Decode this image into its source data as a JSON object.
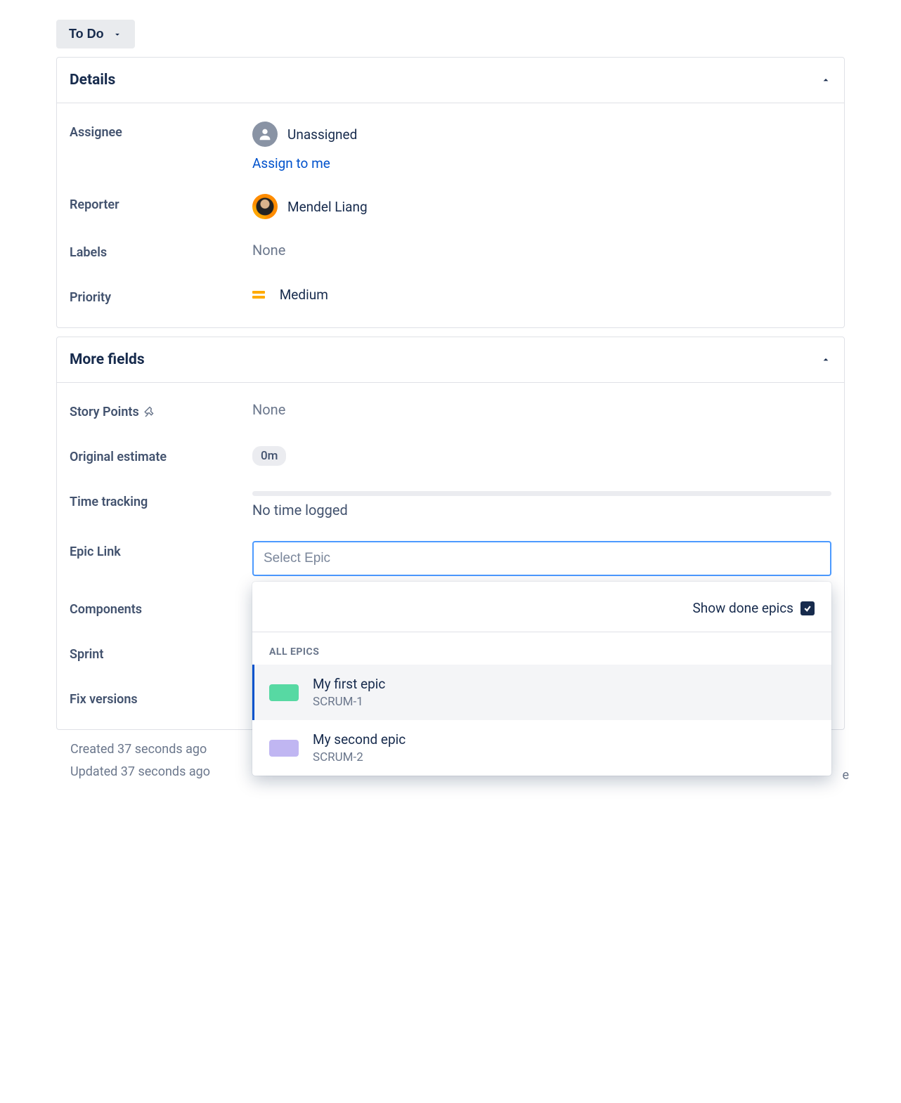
{
  "status": {
    "label": "To Do"
  },
  "details": {
    "heading": "Details",
    "assignee": {
      "label": "Assignee",
      "value": "Unassigned",
      "assign_link": "Assign to me"
    },
    "reporter": {
      "label": "Reporter",
      "value": "Mendel Liang"
    },
    "labels": {
      "label": "Labels",
      "value": "None"
    },
    "priority": {
      "label": "Priority",
      "value": "Medium"
    }
  },
  "more": {
    "heading": "More fields",
    "story_points": {
      "label": "Story Points",
      "value": "None"
    },
    "original_estimate": {
      "label": "Original estimate",
      "value": "0m"
    },
    "time_tracking": {
      "label": "Time tracking",
      "value": "No time logged"
    },
    "epic_link": {
      "label": "Epic Link",
      "placeholder": "Select Epic"
    },
    "components": {
      "label": "Components"
    },
    "sprint": {
      "label": "Sprint"
    },
    "fix_versions": {
      "label": "Fix versions"
    }
  },
  "epic_dropdown": {
    "show_done_label": "Show done epics",
    "group_label": "ALL EPICS",
    "options": [
      {
        "name": "My first epic",
        "key": "SCRUM-1",
        "color": "green",
        "highlight": true
      },
      {
        "name": "My second epic",
        "key": "SCRUM-2",
        "color": "purple",
        "highlight": false
      }
    ]
  },
  "timestamps": {
    "created": "Created 37 seconds ago",
    "updated": "Updated 37 seconds ago"
  },
  "configure_hint": "e"
}
